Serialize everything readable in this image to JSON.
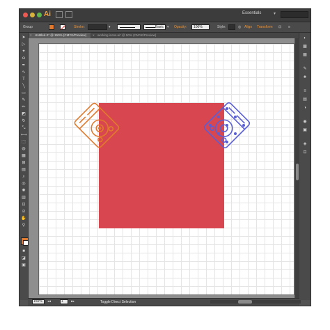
{
  "app": {
    "logo": "Ai",
    "workspace": "Essentials",
    "workspace_caret": "▾"
  },
  "control_bar": {
    "selection_type": "Group",
    "stroke_label": "Stroke:",
    "stroke_weight_caret": "▾",
    "brush_caret": "▾",
    "style_name": "Basic",
    "opacity_label": "Opacity:",
    "opacity_value": "100%",
    "style_label": "Style:",
    "align_label": "Align",
    "transform_label": "Transform",
    "fill_color": "#e17a2c",
    "link_color": "#e8933a"
  },
  "tabs": [
    {
      "label": "Untitled-2* @ 150% (CMYK/Preview)",
      "close": "×",
      "active": true
    },
    {
      "label": "working icons.ai* @ 50% (CMYK/Preview)",
      "close": "×",
      "active": false
    }
  ],
  "tools": [
    "selection-tool",
    "direct-selection-tool",
    "magic-wand-tool",
    "lasso-tool",
    "pen-tool",
    "curvature-tool",
    "type-tool",
    "line-tool",
    "rectangle-tool",
    "paintbrush-tool",
    "pencil-tool",
    "eraser-tool",
    "rotate-tool",
    "scale-tool",
    "width-tool",
    "free-transform-tool",
    "shape-builder-tool",
    "perspective-tool",
    "mesh-tool",
    "gradient-tool",
    "eyedropper-tool",
    "blend-tool",
    "symbol-sprayer-tool",
    "graph-tool",
    "artboard-tool",
    "slice-tool",
    "hand-tool",
    "zoom-tool"
  ],
  "panels": [
    "color-panel",
    "color-guide-panel",
    "swatches-panel",
    "brushes-panel",
    "symbols-panel",
    "stroke-panel",
    "gradient-panel",
    "transparency-panel",
    "appearance-panel",
    "graphic-styles-panel",
    "layers-panel",
    "artboards-panel"
  ],
  "status": {
    "zoom": "150%",
    "page": "1",
    "message": "Toggle Direct Selection"
  },
  "artwork": {
    "rect_color": "#d8474f",
    "left_icon_color": "#e17a2c",
    "right_icon_color": "#5a5ed6"
  }
}
